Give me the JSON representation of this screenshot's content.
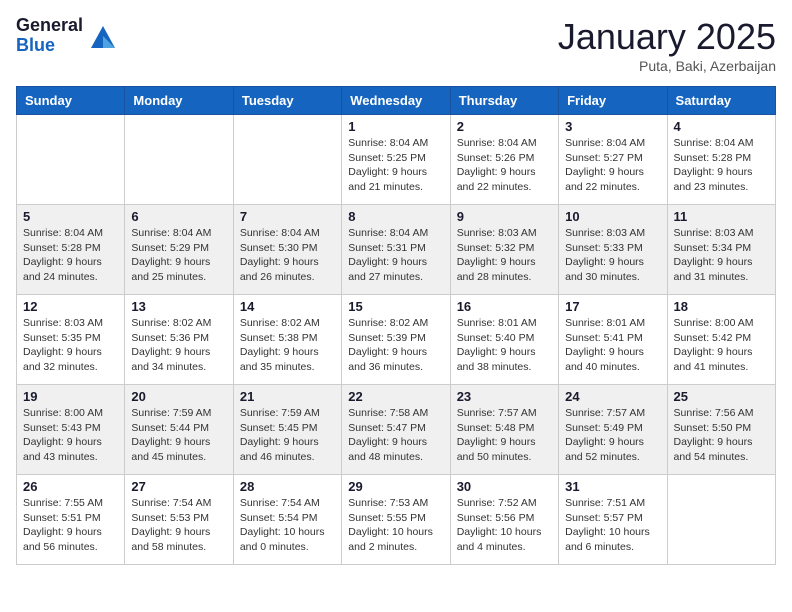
{
  "logo": {
    "general": "General",
    "blue": "Blue"
  },
  "title": "January 2025",
  "location": "Puta, Baki, Azerbaijan",
  "weekdays": [
    "Sunday",
    "Monday",
    "Tuesday",
    "Wednesday",
    "Thursday",
    "Friday",
    "Saturday"
  ],
  "weeks": [
    [
      null,
      null,
      null,
      {
        "day": 1,
        "sunrise": "8:04 AM",
        "sunset": "5:25 PM",
        "daylight": "9 hours and 21 minutes."
      },
      {
        "day": 2,
        "sunrise": "8:04 AM",
        "sunset": "5:26 PM",
        "daylight": "9 hours and 22 minutes."
      },
      {
        "day": 3,
        "sunrise": "8:04 AM",
        "sunset": "5:27 PM",
        "daylight": "9 hours and 22 minutes."
      },
      {
        "day": 4,
        "sunrise": "8:04 AM",
        "sunset": "5:28 PM",
        "daylight": "9 hours and 23 minutes."
      }
    ],
    [
      {
        "day": 5,
        "sunrise": "8:04 AM",
        "sunset": "5:28 PM",
        "daylight": "9 hours and 24 minutes."
      },
      {
        "day": 6,
        "sunrise": "8:04 AM",
        "sunset": "5:29 PM",
        "daylight": "9 hours and 25 minutes."
      },
      {
        "day": 7,
        "sunrise": "8:04 AM",
        "sunset": "5:30 PM",
        "daylight": "9 hours and 26 minutes."
      },
      {
        "day": 8,
        "sunrise": "8:04 AM",
        "sunset": "5:31 PM",
        "daylight": "9 hours and 27 minutes."
      },
      {
        "day": 9,
        "sunrise": "8:03 AM",
        "sunset": "5:32 PM",
        "daylight": "9 hours and 28 minutes."
      },
      {
        "day": 10,
        "sunrise": "8:03 AM",
        "sunset": "5:33 PM",
        "daylight": "9 hours and 30 minutes."
      },
      {
        "day": 11,
        "sunrise": "8:03 AM",
        "sunset": "5:34 PM",
        "daylight": "9 hours and 31 minutes."
      }
    ],
    [
      {
        "day": 12,
        "sunrise": "8:03 AM",
        "sunset": "5:35 PM",
        "daylight": "9 hours and 32 minutes."
      },
      {
        "day": 13,
        "sunrise": "8:02 AM",
        "sunset": "5:36 PM",
        "daylight": "9 hours and 34 minutes."
      },
      {
        "day": 14,
        "sunrise": "8:02 AM",
        "sunset": "5:38 PM",
        "daylight": "9 hours and 35 minutes."
      },
      {
        "day": 15,
        "sunrise": "8:02 AM",
        "sunset": "5:39 PM",
        "daylight": "9 hours and 36 minutes."
      },
      {
        "day": 16,
        "sunrise": "8:01 AM",
        "sunset": "5:40 PM",
        "daylight": "9 hours and 38 minutes."
      },
      {
        "day": 17,
        "sunrise": "8:01 AM",
        "sunset": "5:41 PM",
        "daylight": "9 hours and 40 minutes."
      },
      {
        "day": 18,
        "sunrise": "8:00 AM",
        "sunset": "5:42 PM",
        "daylight": "9 hours and 41 minutes."
      }
    ],
    [
      {
        "day": 19,
        "sunrise": "8:00 AM",
        "sunset": "5:43 PM",
        "daylight": "9 hours and 43 minutes."
      },
      {
        "day": 20,
        "sunrise": "7:59 AM",
        "sunset": "5:44 PM",
        "daylight": "9 hours and 45 minutes."
      },
      {
        "day": 21,
        "sunrise": "7:59 AM",
        "sunset": "5:45 PM",
        "daylight": "9 hours and 46 minutes."
      },
      {
        "day": 22,
        "sunrise": "7:58 AM",
        "sunset": "5:47 PM",
        "daylight": "9 hours and 48 minutes."
      },
      {
        "day": 23,
        "sunrise": "7:57 AM",
        "sunset": "5:48 PM",
        "daylight": "9 hours and 50 minutes."
      },
      {
        "day": 24,
        "sunrise": "7:57 AM",
        "sunset": "5:49 PM",
        "daylight": "9 hours and 52 minutes."
      },
      {
        "day": 25,
        "sunrise": "7:56 AM",
        "sunset": "5:50 PM",
        "daylight": "9 hours and 54 minutes."
      }
    ],
    [
      {
        "day": 26,
        "sunrise": "7:55 AM",
        "sunset": "5:51 PM",
        "daylight": "9 hours and 56 minutes."
      },
      {
        "day": 27,
        "sunrise": "7:54 AM",
        "sunset": "5:53 PM",
        "daylight": "9 hours and 58 minutes."
      },
      {
        "day": 28,
        "sunrise": "7:54 AM",
        "sunset": "5:54 PM",
        "daylight": "10 hours and 0 minutes."
      },
      {
        "day": 29,
        "sunrise": "7:53 AM",
        "sunset": "5:55 PM",
        "daylight": "10 hours and 2 minutes."
      },
      {
        "day": 30,
        "sunrise": "7:52 AM",
        "sunset": "5:56 PM",
        "daylight": "10 hours and 4 minutes."
      },
      {
        "day": 31,
        "sunrise": "7:51 AM",
        "sunset": "5:57 PM",
        "daylight": "10 hours and 6 minutes."
      },
      null
    ]
  ],
  "labels": {
    "sunrise": "Sunrise:",
    "sunset": "Sunset:",
    "daylight": "Daylight:"
  }
}
